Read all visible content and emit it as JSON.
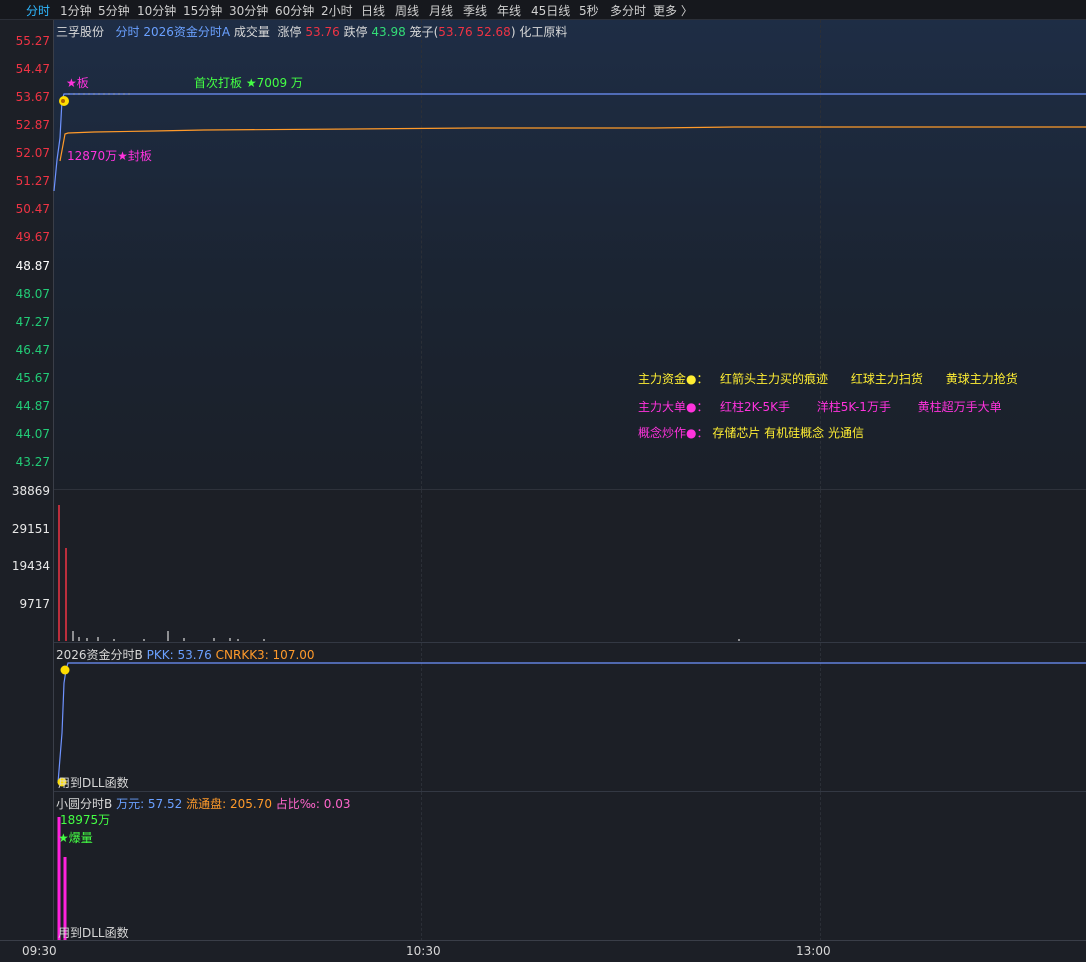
{
  "toolbar": {
    "periods": [
      "分时",
      "1分钟",
      "5分钟",
      "10分钟",
      "15分钟",
      "30分钟",
      "60分钟",
      "2小时",
      "日线",
      "周线",
      "月线",
      "季线",
      "年线",
      "45日线",
      "5秒",
      "多分时",
      "更多 〉"
    ]
  },
  "main_header": {
    "stock_name": "三孚股份",
    "mode": "分时",
    "indicator": "2026资金分时A",
    "volume_label": "成交量",
    "limit_up_label": "涨停",
    "limit_up_value": "53.76",
    "limit_down_label": "跌停",
    "limit_down_value": "43.98",
    "cage_label": "笼子(",
    "cage_value": "53.76 52.68",
    "cage_close": ")",
    "sector": "化工原料"
  },
  "price_axis": [
    "55.27",
    "54.47",
    "53.67",
    "52.87",
    "52.07",
    "51.27",
    "50.47",
    "49.67",
    "48.87",
    "48.07",
    "47.27",
    "46.47",
    "45.67",
    "44.87",
    "44.07",
    "43.27"
  ],
  "volume_axis": [
    "38869",
    "29151",
    "19434",
    "9717"
  ],
  "annotations": {
    "board_star": "★板",
    "first_limit": "首次打板 ★7009 万",
    "seal": "12870万★封板"
  },
  "legend": {
    "row1_title": "主力资金●：",
    "row1_items": [
      "红箭头主力买的痕迹",
      "红球主力扫货",
      "黄球主力抢货"
    ],
    "row2_title": "主力大单●：",
    "row2_items": [
      "红柱2K-5K手",
      "洋柱5K-1万手",
      "黄柱超万手大单"
    ],
    "row3_title": "概念炒作●：",
    "row3_items": "存储芯片 有机硅概念 光通信"
  },
  "panel_b": {
    "name": "2026资金分时B",
    "pkk": "PKK: 53.76",
    "cnrkk": "CNRKK3: 107.00",
    "footer": "用到DLL函数"
  },
  "panel_c": {
    "name": "小圆分时B",
    "wan": "万元: 57.52",
    "float": "流通盘: 205.70",
    "ratio": "占比‰: 0.03",
    "amount": "18975万",
    "burst": "★爆量",
    "footer": "用到DLL函数"
  },
  "time_axis": [
    "09:30",
    "10:30",
    "13:00"
  ],
  "colors": {
    "price_line": "#6f93ff",
    "avg_line": "#ff9a2a",
    "volume_bar_up": "#ee3344",
    "magenta_bar": "#ff22dd",
    "marker_yellow": "#ffdd00"
  }
}
